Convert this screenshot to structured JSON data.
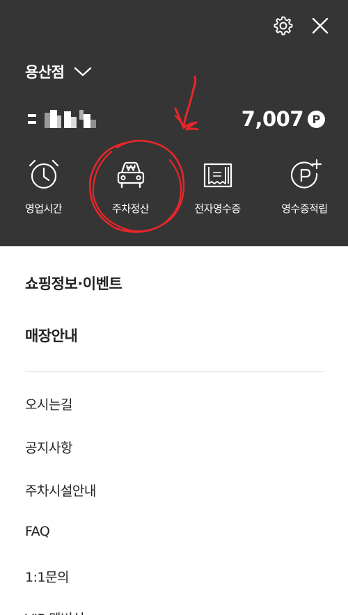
{
  "header": {
    "settings_icon": "gear-icon",
    "close_icon": "close-icon",
    "store_name": "용산점",
    "points": "7,007",
    "points_badge": "P"
  },
  "quick_menu": [
    {
      "label": "영업시간",
      "icon": "alarm-clock-icon"
    },
    {
      "label": "주차정산",
      "icon": "car-won-icon"
    },
    {
      "label": "전자영수증",
      "icon": "receipt-icon"
    },
    {
      "label": "영수증적립",
      "icon": "point-plus-icon"
    }
  ],
  "menu_primary": [
    {
      "label": "쇼핑정보·이벤트"
    },
    {
      "label": "매장안내"
    }
  ],
  "menu_secondary": [
    {
      "label": "오시는길"
    },
    {
      "label": "공지사항"
    },
    {
      "label": "주차시설안내"
    },
    {
      "label": "FAQ"
    },
    {
      "label": "1:1문의"
    },
    {
      "label": "VIP 멤버십"
    }
  ],
  "colors": {
    "header_bg": "#353535",
    "annotation": "#e8262a"
  }
}
